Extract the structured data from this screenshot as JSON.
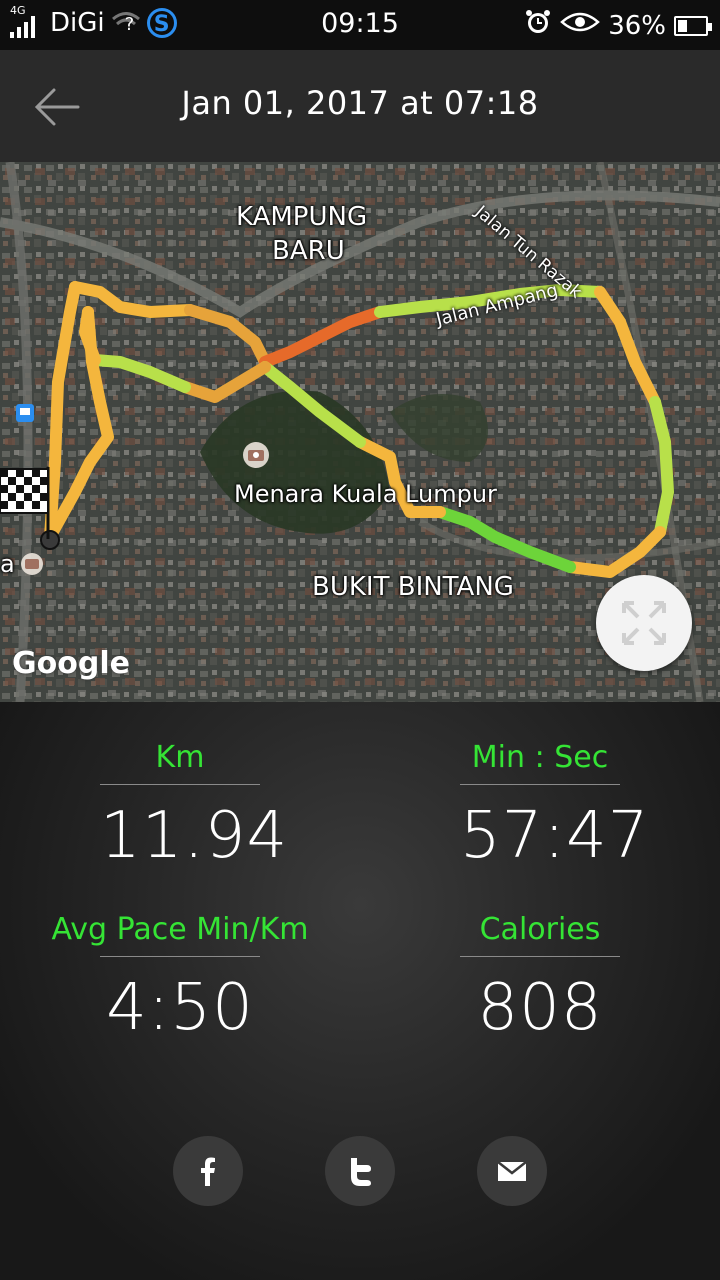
{
  "status_bar": {
    "network_type": "4G",
    "carrier": "DiGi",
    "wifi_status": "?",
    "time": "09:15",
    "battery": "36%",
    "battery_level": 0.36,
    "icons": [
      "signal-icon",
      "wifi-icon",
      "s-app-icon",
      "alarm-icon",
      "eye-icon",
      "battery-icon"
    ]
  },
  "header": {
    "title": "Jan 01, 2017 at 07:18",
    "back_icon": "arrow-left-icon"
  },
  "map": {
    "labels": {
      "kampung_baru_1": "KAMPUNG",
      "kampung_baru_2": "BARU",
      "jalan_tun_razak": "Jalan Tun Razak",
      "jalan_ampang": "Jalan Ampang",
      "menara": "Menara Kuala Lumpur",
      "bukit_bintang": "BUKIT BINTANG",
      "partial_left": "a"
    },
    "attribution": "Google",
    "expand_icon": "fullscreen-expand-icon",
    "start_finish_icon": "checkered-flag-icon",
    "route_colors": {
      "fast": "#3fd63f",
      "mid": "#b8e04a",
      "slow": "#f4b63d",
      "slowest": "#e66a2a"
    }
  },
  "stats": {
    "distance": {
      "label": "Km",
      "value": "11.94"
    },
    "duration": {
      "label": "Min : Sec",
      "value": "57:47"
    },
    "pace": {
      "label": "Avg Pace Min/Km",
      "value": "4:50"
    },
    "calories": {
      "label": "Calories",
      "value": "808"
    }
  },
  "share": {
    "facebook_icon": "facebook-icon",
    "twitter_icon": "twitter-icon",
    "email_icon": "email-icon"
  },
  "colors": {
    "accent": "#35e435",
    "header_bg": "#2a2a2a",
    "status_bg": "#0e0e0e"
  }
}
